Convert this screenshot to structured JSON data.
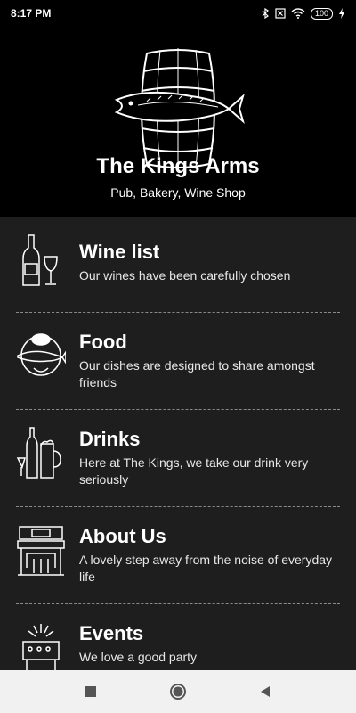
{
  "status_bar": {
    "time": "8:17 PM",
    "battery": "100",
    "icons": [
      "bluetooth-icon",
      "close-box-icon",
      "wifi-icon",
      "battery-icon",
      "charging-icon"
    ]
  },
  "hero": {
    "title": "The Kings Arms",
    "subtitle": "Pub, Bakery, Wine Shop",
    "logo_icon": "barrel-fish-logo"
  },
  "menu": {
    "items": [
      {
        "title": "Wine list",
        "description": "Our wines have been carefully chosen",
        "icon": "wine-bottle-glass-icon"
      },
      {
        "title": "Food",
        "description": "Our dishes are designed to share amongst friends",
        "icon": "fish-plate-icon"
      },
      {
        "title": "Drinks",
        "description": "Here at The Kings, we take our drink very seriously",
        "icon": "drinks-icon"
      },
      {
        "title": "About Us",
        "description": "A lovely step away from the noise of everyday life",
        "icon": "pub-building-icon"
      },
      {
        "title": "Events",
        "description": "We love a good party",
        "icon": "fireworks-icon"
      }
    ]
  },
  "nav_bar": {
    "buttons": [
      "recents-button",
      "home-button",
      "back-button"
    ]
  },
  "colors": {
    "hero_bg": "#000000",
    "menu_bg": "#1e1e1e",
    "nav_bg": "#f1f1f1",
    "text": "#ffffff"
  }
}
